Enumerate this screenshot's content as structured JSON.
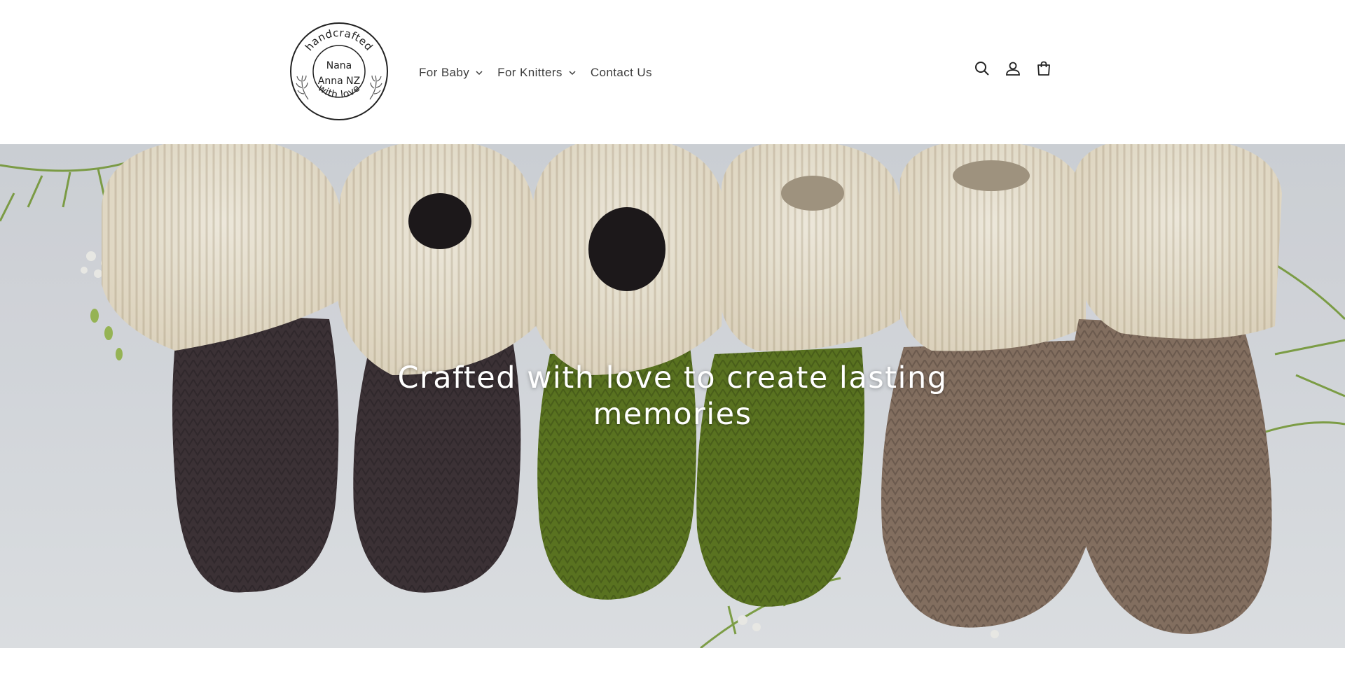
{
  "logo": {
    "text_top": "handcrafted",
    "text_middle_1": "Nana",
    "text_middle_2": "Anna NZ",
    "text_bottom": "with love"
  },
  "nav": {
    "items": [
      {
        "label": "For Baby",
        "has_dropdown": true
      },
      {
        "label": "For Knitters",
        "has_dropdown": true
      },
      {
        "label": "Contact Us",
        "has_dropdown": false
      }
    ]
  },
  "header_icons": [
    "search-icon",
    "account-icon",
    "cart-icon"
  ],
  "hero": {
    "title": "Crafted with love to create lasting memories"
  },
  "colors": {
    "nav_text": "#3d3d3d",
    "hero_text": "#ffffff",
    "bootie_dark": "#3f3539",
    "bootie_green": "#5f7a22",
    "bootie_taupe": "#8b7565",
    "cuff_cream": "#f3ecda"
  }
}
